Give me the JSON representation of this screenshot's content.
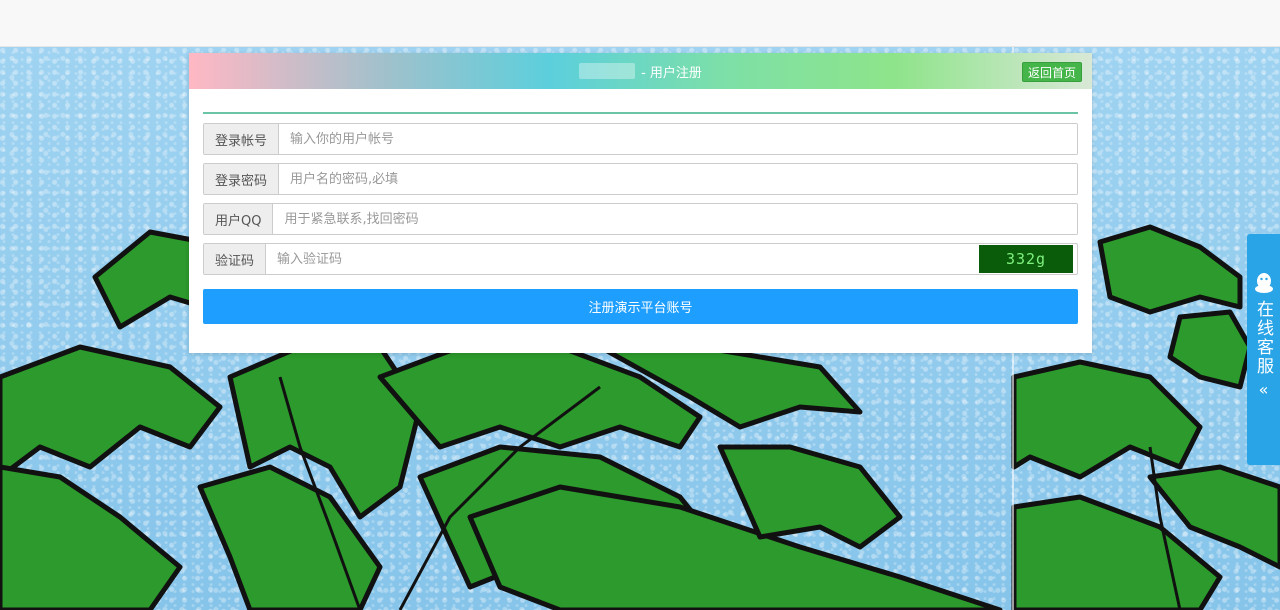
{
  "panel": {
    "title": "- 用户注册",
    "home_button": "返回首页"
  },
  "form": {
    "account": {
      "label": "登录帐号",
      "placeholder": "输入你的用户帐号"
    },
    "password": {
      "label": "登录密码",
      "placeholder": "用户名的密码,必填"
    },
    "qq": {
      "label": "用户QQ",
      "placeholder": "用于紧急联系,找回密码"
    },
    "captcha": {
      "label": "验证码",
      "placeholder": "输入验证码",
      "image_text": "332g"
    },
    "submit_label": "注册演示平台账号"
  },
  "service": {
    "label": "在线客服",
    "arrow": "«",
    "icon": "qq-penguin-icon"
  },
  "colors": {
    "submit": "#1e9fff",
    "home_button": "#44b549",
    "service": "#29a4e6",
    "captcha_bg": "#0a5c0a"
  }
}
